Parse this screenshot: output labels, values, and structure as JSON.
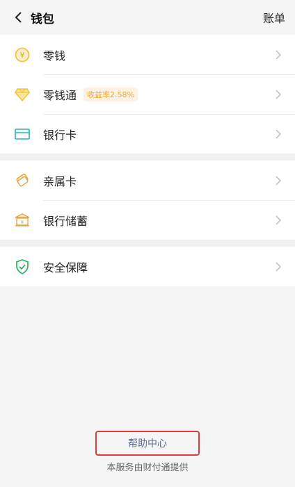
{
  "header": {
    "title": "钱包",
    "bill_label": "账单"
  },
  "groups": [
    {
      "items": [
        {
          "label": "零钱",
          "icon": "coin-yuan-icon"
        },
        {
          "label": "零钱通",
          "icon": "diamond-icon",
          "badge": "收益率2.58%"
        },
        {
          "label": "银行卡",
          "icon": "bank-card-icon"
        }
      ]
    },
    {
      "items": [
        {
          "label": "亲属卡",
          "icon": "family-card-icon"
        },
        {
          "label": "银行储蓄",
          "icon": "bank-building-icon"
        }
      ]
    },
    {
      "items": [
        {
          "label": "安全保障",
          "icon": "shield-check-icon"
        }
      ]
    }
  ],
  "footer": {
    "help_label": "帮助中心",
    "provider_text": "本服务由财付通提供"
  },
  "colors": {
    "accent_yellow": "#f2c33a",
    "badge_text": "#f0a63b",
    "card_teal": "#2bb3b1",
    "shield_green": "#27b25f",
    "help_highlight": "#e23b3b"
  }
}
